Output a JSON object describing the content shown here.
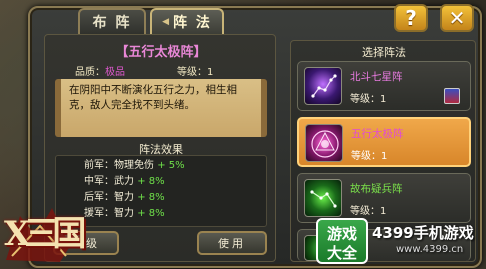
{
  "tabs": [
    {
      "label": "布 阵"
    },
    {
      "label": "阵 法"
    }
  ],
  "header_buttons": {
    "help": "?",
    "close": "✕"
  },
  "formation": {
    "title": "【五行太极阵】",
    "quality_label": "品质：",
    "quality_value": "极品",
    "level_label": "等级：1",
    "description": "在阴阳中不断演化五行之力，相生相克，敌人完全找不到头绪。",
    "effect_title": "阵法效果",
    "effects": [
      {
        "pos": "前军：",
        "attr": "物理免伤",
        "bonus": "+ 5%"
      },
      {
        "pos": "中军：",
        "attr": "武力",
        "bonus": "+ 8%"
      },
      {
        "pos": "后军：",
        "attr": "智力",
        "bonus": "+ 8%"
      },
      {
        "pos": "援军：",
        "attr": "智力",
        "bonus": "+ 8%"
      }
    ],
    "upgrade_label": "升级",
    "use_label": "使用"
  },
  "select_panel": {
    "title": "选择阵法",
    "cards": [
      {
        "name": "北斗七星阵",
        "level": "等级：1",
        "name_color": "#e87be0",
        "icon": "star-constellation-icon"
      },
      {
        "name": "五行太极阵",
        "level": "等级：1",
        "name_color": "#e24ad4",
        "icon": "taiji-circle-icon"
      },
      {
        "name": "故布疑兵阵",
        "level": "等级：1",
        "name_color": "#7ae04a",
        "icon": "green-constellation-icon"
      }
    ]
  },
  "logo_text": "X三国",
  "watermark": {
    "box_top": "游戏",
    "box_bottom": "大全",
    "name": "4399手机游戏",
    "url": "www.4399.cn"
  }
}
